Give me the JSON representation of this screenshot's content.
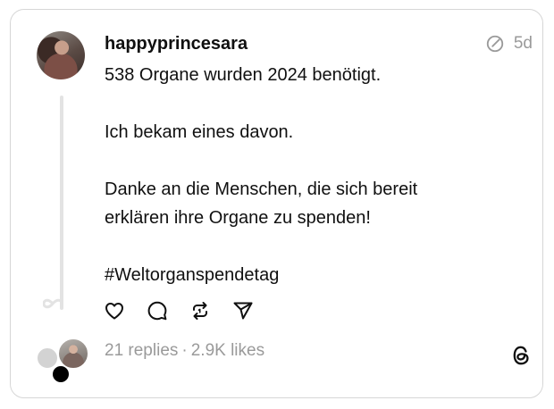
{
  "post": {
    "username": "happyprincesara",
    "time": "5d",
    "lines": [
      "538 Organe wurden 2024 benötigt.",
      "",
      "Ich bekam eines davon.",
      "",
      "Danke an die Menschen, die sich bereit",
      "erklären ihre Organe zu spenden!",
      "",
      "#Weltorganspendetag"
    ]
  },
  "actions": [
    "heart-icon",
    "comment-icon",
    "repost-icon",
    "share-icon"
  ],
  "stats": {
    "replies": "21 replies",
    "separator": "·",
    "likes": "2.9K likes"
  },
  "icons": {
    "edited": "edited-icon",
    "brand": "threads-logo-icon"
  }
}
